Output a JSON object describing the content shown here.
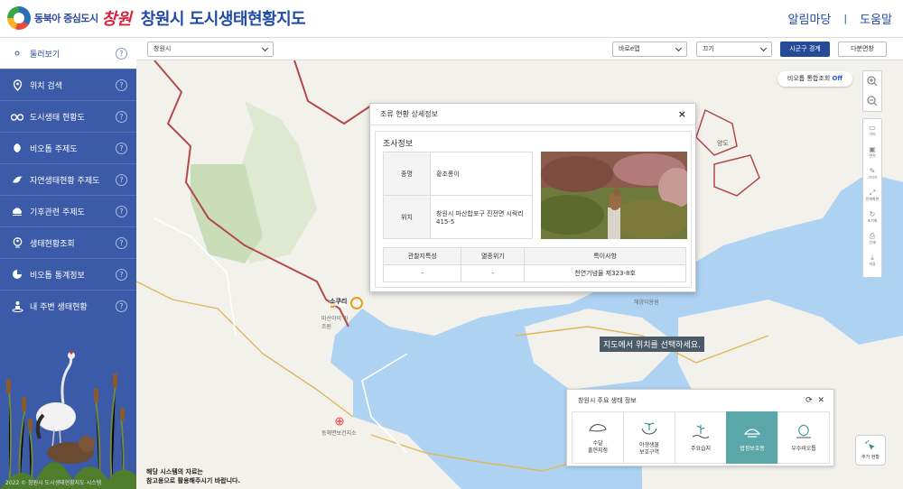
{
  "header": {
    "logo_slogan": "동북아 중심도시",
    "logo_city": "창원",
    "site_title": "창원시 도시생태현황지도",
    "nav": [
      "알림마당",
      "도움말"
    ],
    "nav_sep": "|"
  },
  "sidebar": {
    "items": [
      {
        "label": "둘러보기",
        "icon": "search-doc-icon",
        "active": true
      },
      {
        "label": "위치 검색",
        "icon": "map-pin-icon"
      },
      {
        "label": "도시생태 현황도",
        "icon": "binoculars-icon"
      },
      {
        "label": "비오톱 주제도",
        "icon": "leaf-icon"
      },
      {
        "label": "자연생태현황 주제도",
        "icon": "bird-icon"
      },
      {
        "label": "기후관련 주제도",
        "icon": "cloud-icon"
      },
      {
        "label": "생태현황조회",
        "icon": "person-pin-icon"
      },
      {
        "label": "비오톱 통계정보",
        "icon": "pie-chart-icon"
      },
      {
        "label": "내 주변 생태현황",
        "icon": "person-location-icon"
      }
    ],
    "help_glyph": "?",
    "copyright": "2022 © 창원시 도시생태현황지도 시스템"
  },
  "toolbar": {
    "region_select": "창원시",
    "basemap_select": "바로e맵",
    "layer_select": "끄기",
    "boundary_button": "시군구 경계",
    "split_button": "다분면창"
  },
  "map": {
    "biotope_toggle_label": "비오톱 통합조회",
    "biotope_toggle_state": "Off",
    "island_label": "양도",
    "marker_label": "소쿠리",
    "tooltip": "지도에서 위치를 선택하세요.",
    "poi_school": "동해면보건지소",
    "poi_park": "해양이용원",
    "poi_wetland": "마산아이 라조원",
    "tools": [
      {
        "label": "거리",
        "icon": "ruler-icon",
        "glyph": "▭"
      },
      {
        "label": "면적",
        "icon": "area-icon",
        "glyph": "▣"
      },
      {
        "label": "그리기",
        "icon": "pencil-icon",
        "glyph": "✎"
      },
      {
        "label": "전체화면",
        "icon": "fullscreen-icon",
        "glyph": "⤢"
      },
      {
        "label": "초기화",
        "icon": "reset-icon",
        "glyph": "↻"
      },
      {
        "label": "인쇄",
        "icon": "print-icon",
        "glyph": "⎙"
      },
      {
        "label": "저장",
        "icon": "download-icon",
        "glyph": "⤓"
      }
    ]
  },
  "popup": {
    "title": "조류 현황 상세정보",
    "close": "×",
    "section": "조사정보",
    "rows": [
      {
        "key": "종명",
        "value": "황조롱이"
      },
      {
        "key": "위치",
        "value": "창원시 마산합포구 진전면 시락리 415-5"
      }
    ],
    "stats_headers": [
      "관찰지특성",
      "멸종위기",
      "특이사항"
    ],
    "stats_values": [
      "-",
      "-",
      "천연기념물 제323-8호"
    ]
  },
  "eco_panel": {
    "title": "창원시 주요 생태 정보",
    "items": [
      {
        "label": "수달\n출현지점",
        "icon": "otter-icon"
      },
      {
        "label": "야생생물\n보호구역",
        "icon": "hands-plant-icon"
      },
      {
        "label": "주요습지",
        "icon": "wetland-icon"
      },
      {
        "label": "법정보호종",
        "icon": "protected-species-icon",
        "active": true
      },
      {
        "label": "우수비오톱",
        "icon": "biotope-icon"
      }
    ]
  },
  "add_button": "추가 현황",
  "notice": [
    "해당 시스템의 자료는",
    "참고용으로 활용해주시기 바랍니다."
  ],
  "colors": {
    "sidebar": "#3b5aa8",
    "brand": "#1f4aa8",
    "sea": "#aed2f2",
    "active_tile": "#5aa6a8"
  }
}
